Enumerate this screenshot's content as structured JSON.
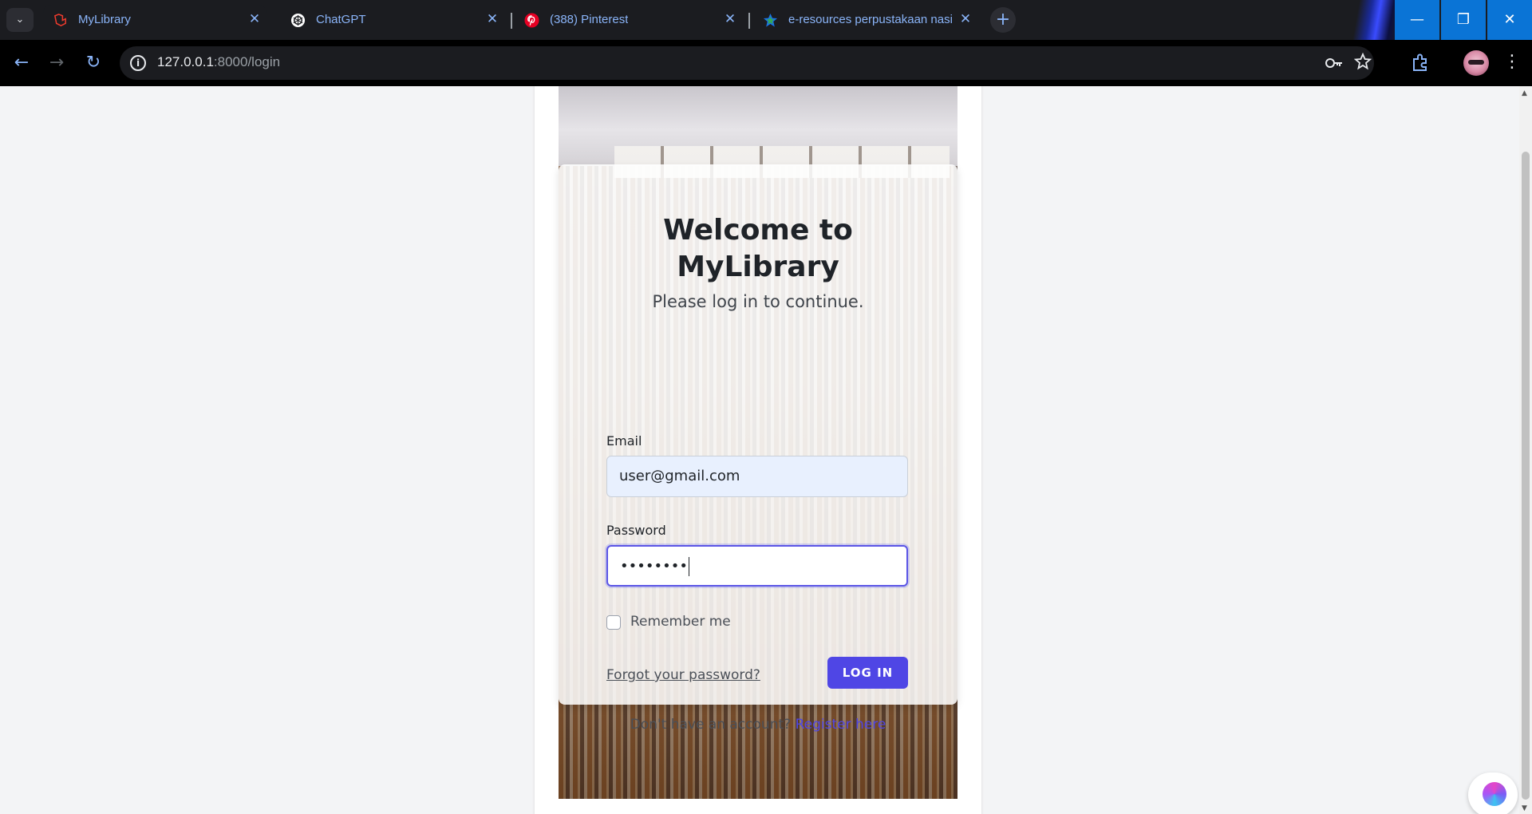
{
  "browser": {
    "tabs": [
      {
        "title": "MyLibrary",
        "favicon": "laravel-icon",
        "active": true
      },
      {
        "title": "ChatGPT",
        "favicon": "openai-icon",
        "active": false
      },
      {
        "title": "(388) Pinterest",
        "favicon": "pinterest-icon",
        "active": false
      },
      {
        "title": "e-resources perpustakaan nasio",
        "favicon": "star-icon",
        "active": false
      }
    ],
    "close_glyph": "✕",
    "new_tab_glyph": "+",
    "window_controls": {
      "minimize": "—",
      "restore": "❐",
      "close": "✕"
    },
    "url_host": "127.0.0.1",
    "url_rest": ":8000/login",
    "nav": {
      "back": "←",
      "forward": "→",
      "reload": "↻"
    }
  },
  "login": {
    "heading_line1": "Welcome to",
    "heading_line2": "MyLibrary",
    "subtitle": "Please log in to continue.",
    "email_label": "Email",
    "email_value": "user@gmail.com",
    "password_label": "Password",
    "password_mask": "••••••••",
    "remember_label": "Remember me",
    "forgot_link": "Forgot your password?",
    "login_button": "LOG IN",
    "register_prompt": "Don't have an account?",
    "register_link": "Register here"
  },
  "colors": {
    "accent": "#4f46e5",
    "chrome_bg": "#1b1c20",
    "window_control_bg": "#0a74d6",
    "tab_text": "#8ab4f8"
  }
}
